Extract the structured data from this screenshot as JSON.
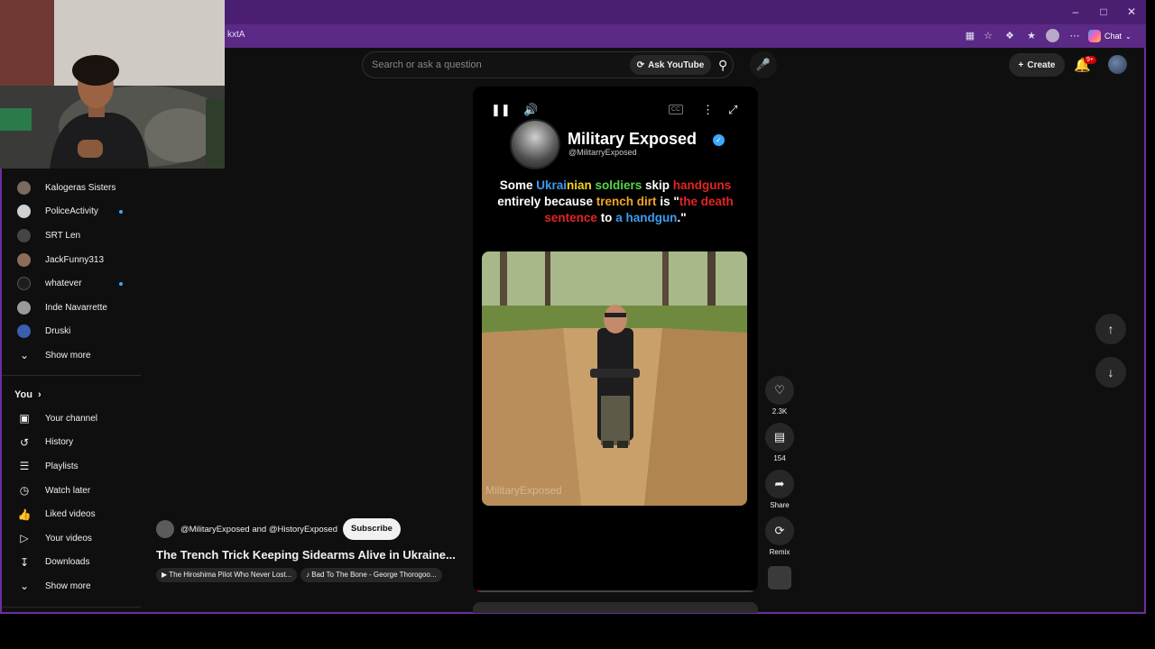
{
  "browser": {
    "address_fragment": "kxtA",
    "chat_label": "Chat",
    "window_controls": [
      "minimize-icon",
      "maximize-icon",
      "close-icon"
    ]
  },
  "masthead": {
    "search_placeholder": "Search or ask a question",
    "ask_label": "Ask YouTube",
    "create_label": "Create",
    "notification_badge": "9+"
  },
  "sidebar": {
    "subscriptions": [
      {
        "label": "Kalogeras Sisters",
        "live": false
      },
      {
        "label": "PoliceActivity",
        "live": true
      },
      {
        "label": "SRT Len",
        "live": false
      },
      {
        "label": "JackFunny313",
        "live": false
      },
      {
        "label": "whatever",
        "live": true
      },
      {
        "label": "Inde Navarrette",
        "live": false
      },
      {
        "label": "Druski",
        "live": false
      }
    ],
    "show_more_1": "Show more",
    "you_heading": "You",
    "you_items": [
      {
        "label": "Your channel",
        "icon": "person-box-icon"
      },
      {
        "label": "History",
        "icon": "history-icon"
      },
      {
        "label": "Playlists",
        "icon": "playlist-icon"
      },
      {
        "label": "Watch later",
        "icon": "clock-icon"
      },
      {
        "label": "Liked videos",
        "icon": "thumbs-up-icon"
      },
      {
        "label": "Your videos",
        "icon": "play-box-icon"
      },
      {
        "label": "Downloads",
        "icon": "download-icon"
      }
    ],
    "show_more_2": "Show more"
  },
  "short": {
    "channel_name": "Military Exposed",
    "channel_handle": "@MilitarryExposed",
    "caption_parts": [
      {
        "text": "Some ",
        "color": "white"
      },
      {
        "text": "Ukrai",
        "color": "blue"
      },
      {
        "text": "nian ",
        "color": "yellow"
      },
      {
        "text": "soldiers ",
        "color": "green"
      },
      {
        "text": "skip ",
        "color": "white"
      },
      {
        "text": "handguns ",
        "color": "red"
      },
      {
        "text": "entirely because ",
        "color": "white"
      },
      {
        "text": "trench dirt ",
        "color": "orange"
      },
      {
        "text": "is \"",
        "color": "white"
      },
      {
        "text": "the death sentence ",
        "color": "red"
      },
      {
        "text": "to ",
        "color": "white"
      },
      {
        "text": "a handgun",
        "color": "blue"
      },
      {
        "text": ".\"",
        "color": "white"
      }
    ],
    "watermark": "MilitaryExposed",
    "progress_fraction": 0.01
  },
  "actions": {
    "likes": "2.3K",
    "comments": "154",
    "share_label": "Share",
    "remix_label": "Remix"
  },
  "meta": {
    "channels_text": "@MilitaryExposed and @HistoryExposed",
    "subscribe_label": "Subscribe",
    "title": "The Trench Trick Keeping Sidearms Alive in Ukraine...",
    "chip_related": "The Hiroshima Pilot Who Never Lost...",
    "chip_music": "Bad To The Bone - George Thorogoo..."
  },
  "colors": {
    "frame_purple": "#6b2fa0",
    "accent_red": "#ff0000",
    "verified_blue": "#3ea6ff"
  }
}
